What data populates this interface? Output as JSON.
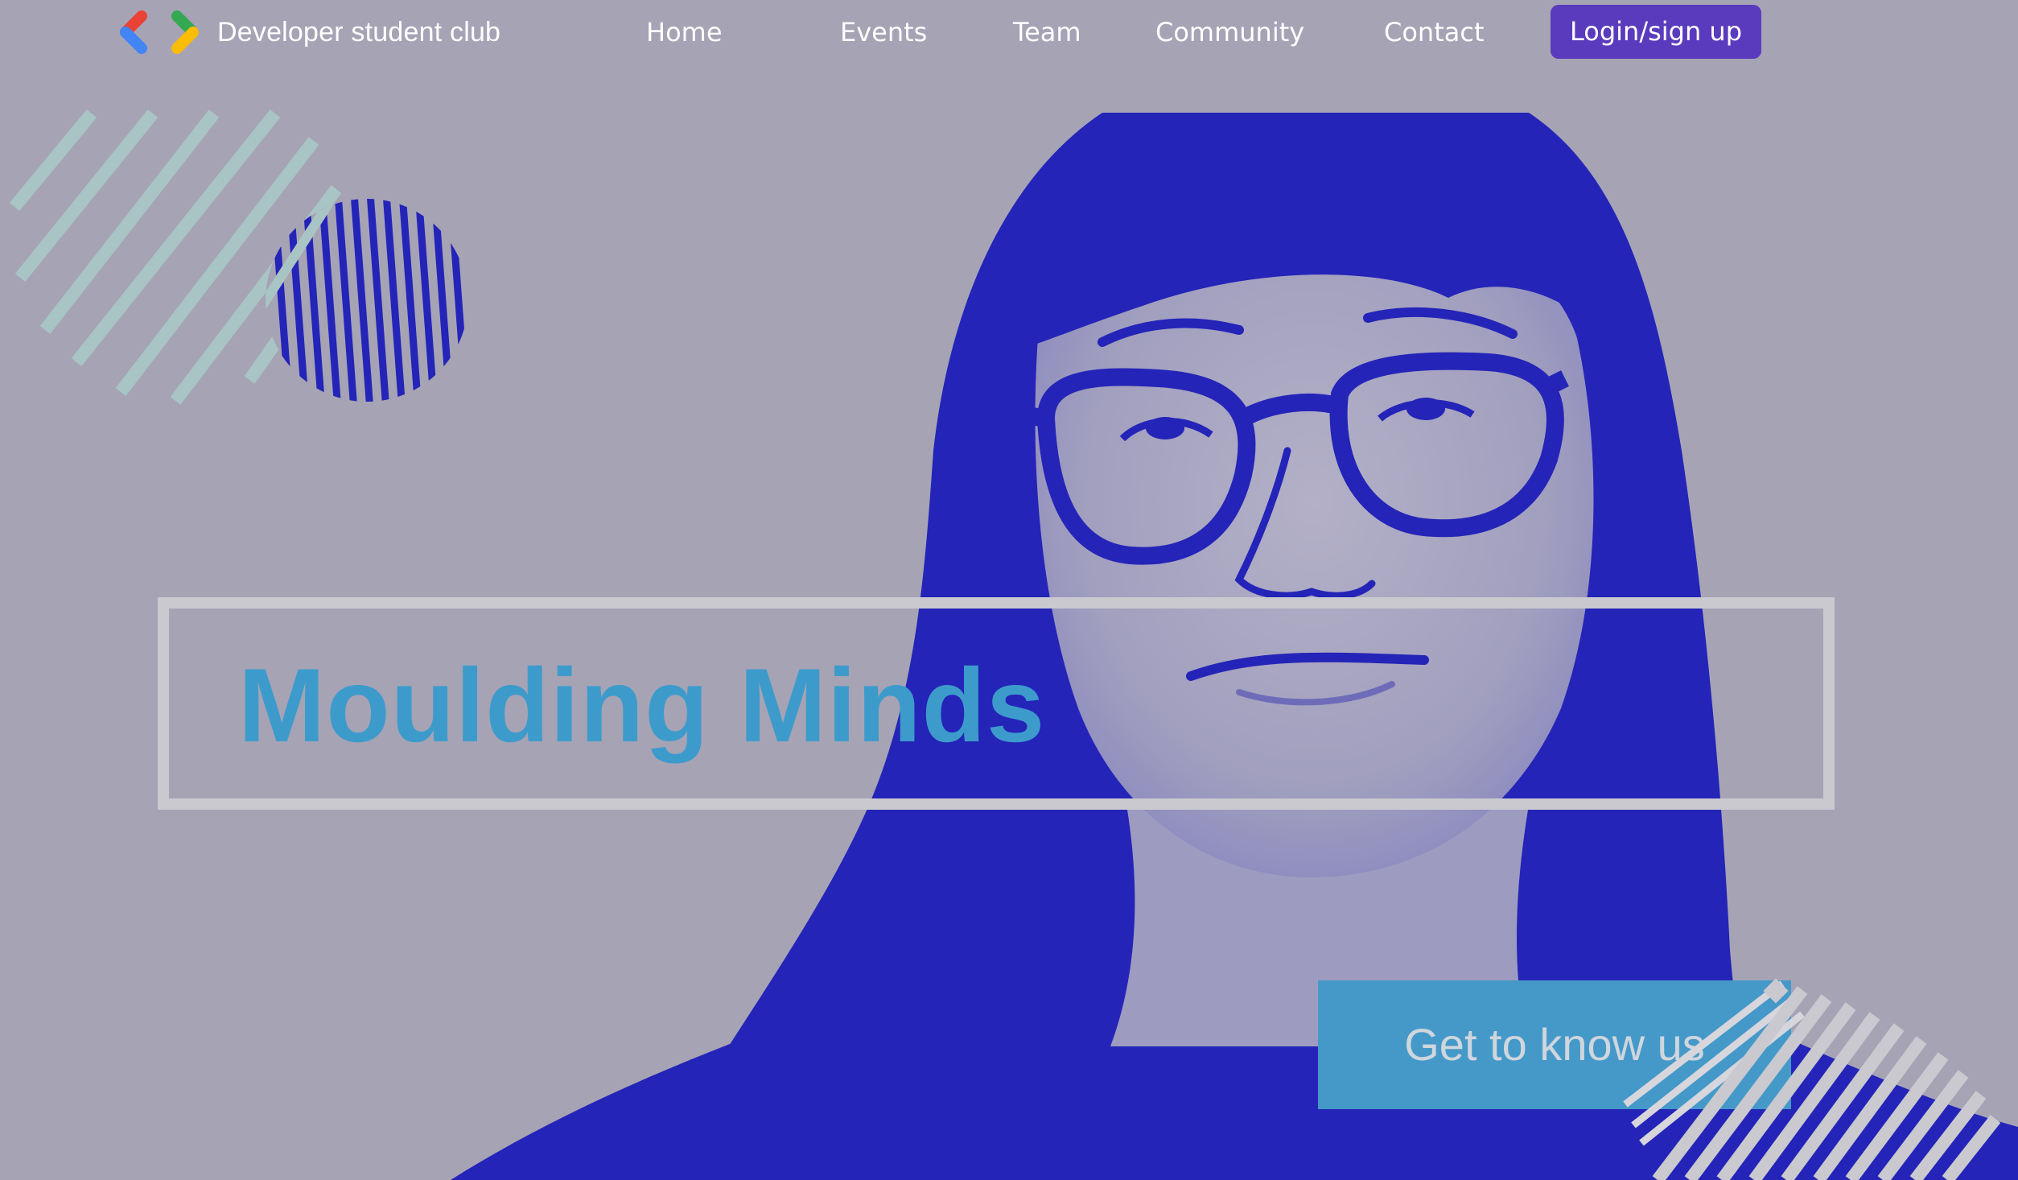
{
  "colors": {
    "background": "#a6a3b5",
    "accent_purple": "#5b3bbd",
    "duotone_blue": "#2424b8",
    "headline_blue": "#3d9bcc",
    "cta_blue": "#4599c9",
    "frame_gray": "#c9c9cf",
    "stripe_mint": "#a9c4c4"
  },
  "navbar": {
    "brand": {
      "logo_icon": "google-developers-brackets-logo",
      "name": "Developer student club"
    },
    "links": [
      {
        "label": "Home"
      },
      {
        "label": "Events"
      },
      {
        "label": "Team"
      },
      {
        "label": "Community"
      },
      {
        "label": "Contact"
      }
    ],
    "login_label": "Login/sign up"
  },
  "hero": {
    "image_description_icon": "duotone-portrait-photo",
    "headline": "Moulding Minds",
    "cta_label": "Get to know us",
    "decorations": [
      "diagonal-stripes",
      "striped-circle",
      "corner-stripes"
    ]
  }
}
